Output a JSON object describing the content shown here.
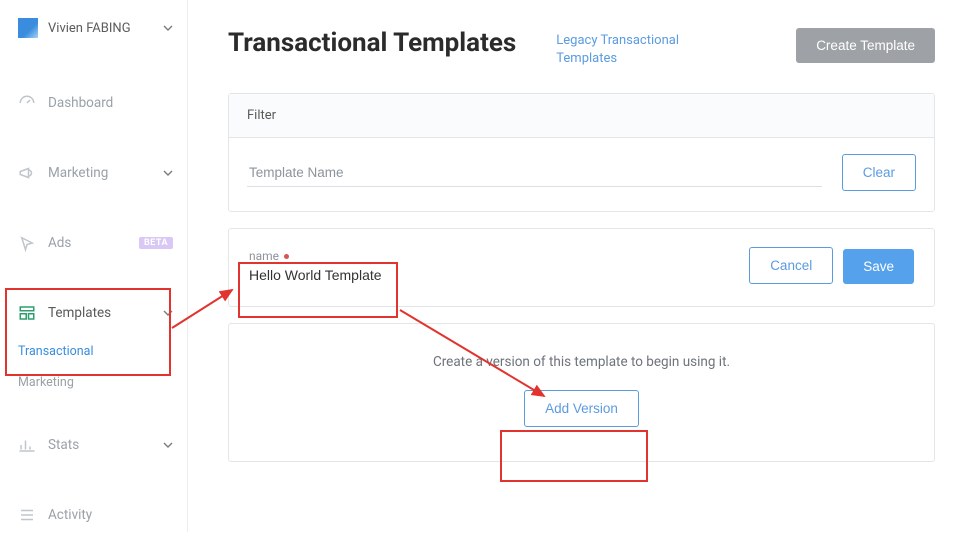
{
  "account": {
    "name": "Vivien FABING"
  },
  "sidebar": {
    "items": [
      {
        "label": "Dashboard"
      },
      {
        "label": "Marketing"
      },
      {
        "label": "Ads",
        "badge": "BETA"
      },
      {
        "label": "Templates"
      },
      {
        "label": "Stats"
      },
      {
        "label": "Activity"
      }
    ],
    "sub_templates": [
      {
        "label": "Transactional"
      },
      {
        "label": "Marketing"
      }
    ]
  },
  "header": {
    "title": "Transactional Templates",
    "legacy_link": "Legacy Transactional Templates",
    "create_btn": "Create Template"
  },
  "filter": {
    "label": "Filter",
    "placeholder": "Template Name",
    "clear_btn": "Clear"
  },
  "name_form": {
    "label": "name",
    "value": "Hello World Template",
    "cancel_btn": "Cancel",
    "save_btn": "Save"
  },
  "version": {
    "message": "Create a version of this template to begin using it.",
    "add_btn": "Add Version"
  }
}
